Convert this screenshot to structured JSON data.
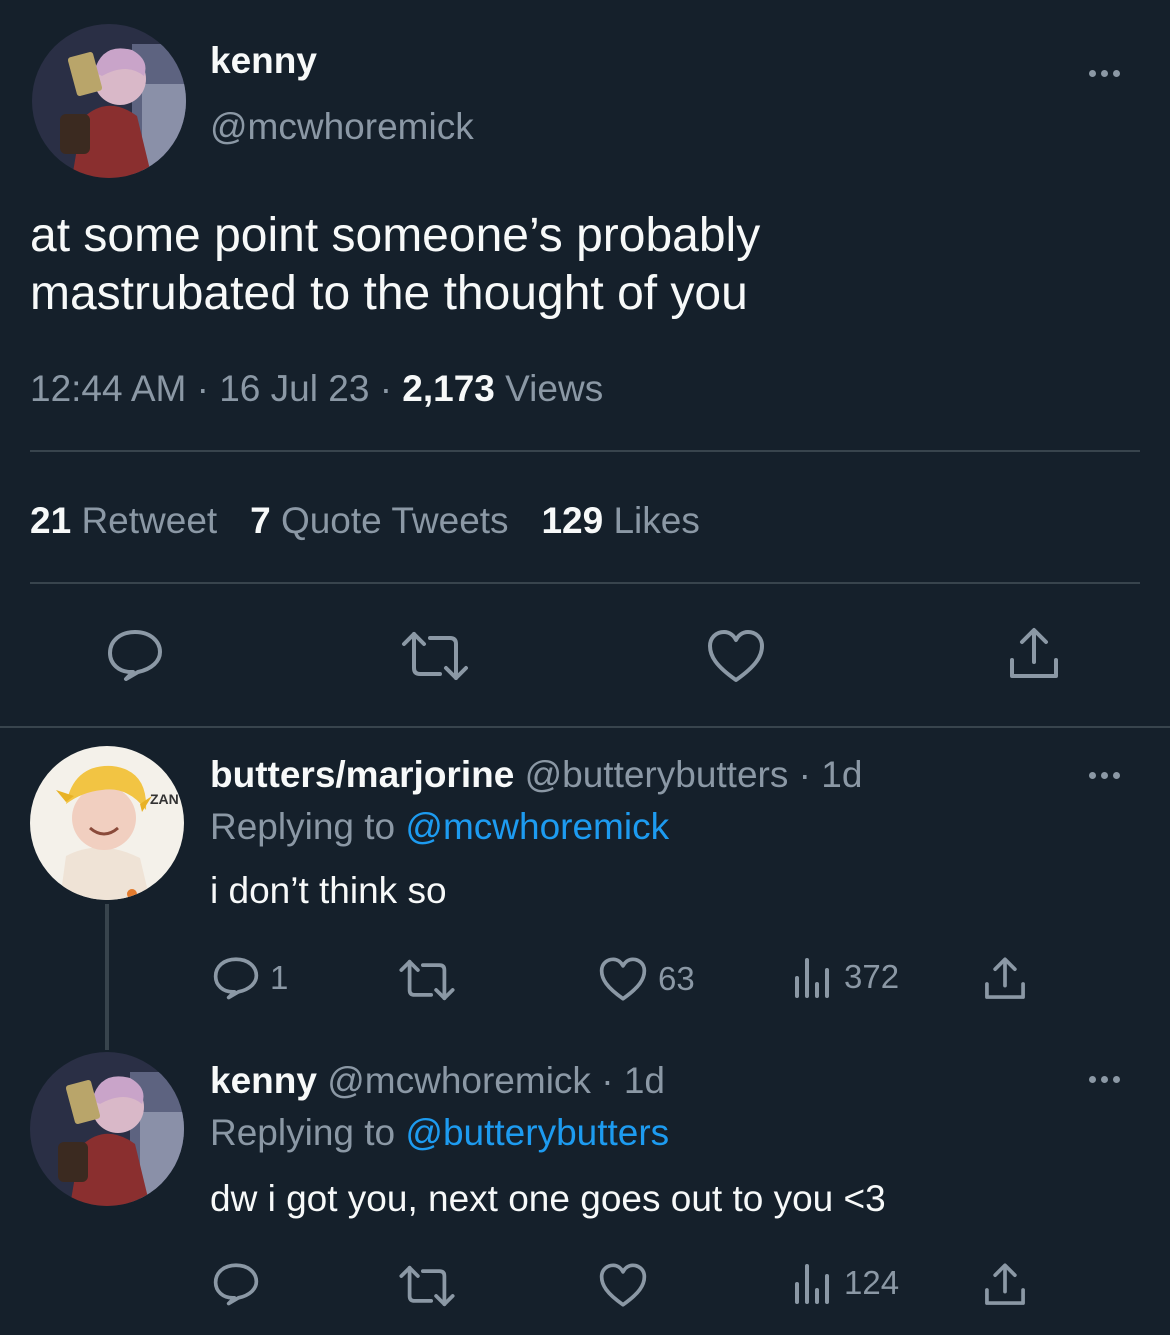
{
  "main_tweet": {
    "display_name": "kenny",
    "handle": "@mcwhoremick",
    "text_line1": "at some point someone’s probably",
    "text_line2": "mastrubated to the thought of you",
    "time": "12:44 AM",
    "sep1": "·",
    "date": "16 Jul 23",
    "sep2": "·",
    "views_count": "2,173",
    "views_label": "Views",
    "retweets_count": "21",
    "retweets_label": "Retweet",
    "quotes_count": "7",
    "quotes_label": "Quote Tweets",
    "likes_count": "129",
    "likes_label": "Likes"
  },
  "reply1": {
    "display_name": "butters/marjorine",
    "handle": "@butterybutters",
    "sep": "·",
    "age": "1d",
    "replying_prefix": "Replying to",
    "replying_to": "@mcwhoremick",
    "text": "i don’t think so",
    "reply_count": "1",
    "like_count": "63",
    "view_count": "372",
    "avatar_badge": "ZAN"
  },
  "reply2": {
    "display_name": "kenny",
    "handle": "@mcwhoremick",
    "sep": "·",
    "age": "1d",
    "replying_prefix": "Replying to",
    "replying_to": "@butterybutters",
    "text": "dw i got you, next one goes out to you <3",
    "view_count": "124"
  },
  "colors": {
    "background": "#15202b",
    "text": "#f7f9f9",
    "muted": "#8b98a5",
    "link": "#1d9bf0",
    "divider": "#38444d"
  },
  "icons": [
    "more-icon",
    "reply-icon",
    "retweet-icon",
    "like-icon",
    "share-icon",
    "views-icon"
  ]
}
